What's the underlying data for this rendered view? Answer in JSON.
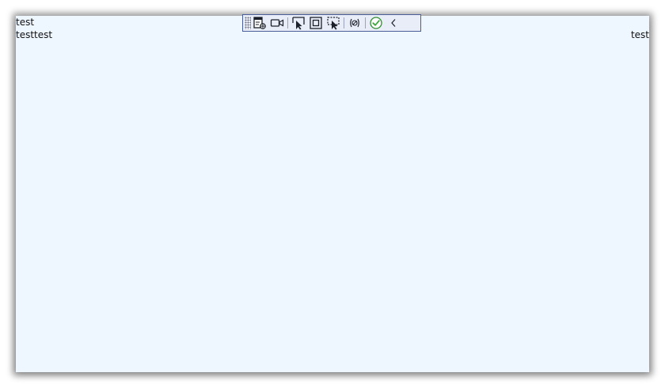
{
  "content": {
    "line1": "test",
    "line2_left": "testtest",
    "line2_right": "test"
  },
  "toolbar": {
    "buttons": [
      {
        "name": "select-element-icon"
      },
      {
        "name": "record-video-icon"
      },
      {
        "name": "pointer-select-icon"
      },
      {
        "name": "frame-select-icon"
      },
      {
        "name": "region-select-icon"
      },
      {
        "name": "toggle-binding-icon"
      },
      {
        "name": "confirm-check-icon"
      },
      {
        "name": "collapse-chevron-icon"
      }
    ]
  },
  "colors": {
    "page_background": "#eef6ff",
    "toolbar_background": "#e9edf7",
    "toolbar_border": "#4a5e9a",
    "confirm_green": "#3fa63f"
  }
}
